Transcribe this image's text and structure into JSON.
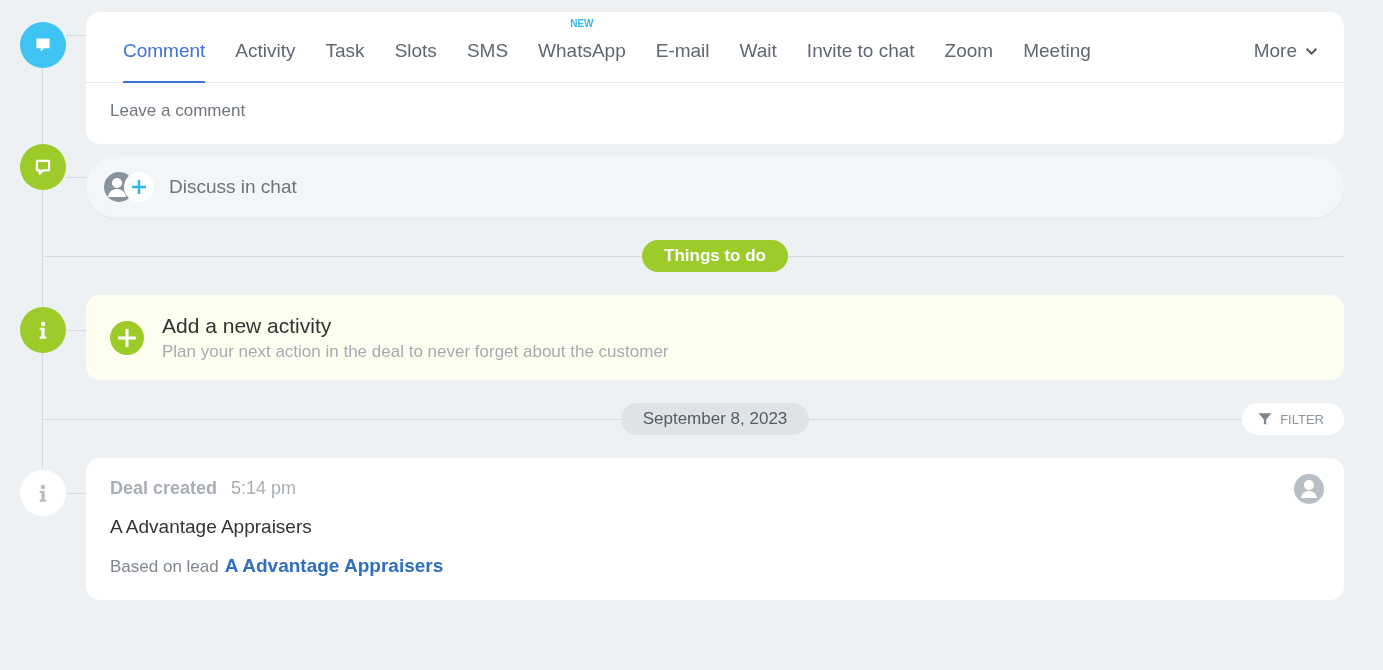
{
  "composer": {
    "tabs": [
      {
        "label": "Comment",
        "selected": true
      },
      {
        "label": "Activity",
        "selected": false
      },
      {
        "label": "Task",
        "selected": false
      },
      {
        "label": "Slots",
        "selected": false
      },
      {
        "label": "SMS",
        "selected": false
      },
      {
        "label": "WhatsApp",
        "selected": false,
        "badge": "NEW"
      },
      {
        "label": "E-mail",
        "selected": false
      },
      {
        "label": "Wait",
        "selected": false
      },
      {
        "label": "Invite to chat",
        "selected": false
      },
      {
        "label": "Zoom",
        "selected": false
      },
      {
        "label": "Meeting",
        "selected": false
      }
    ],
    "more": "More",
    "placeholder": "Leave a comment"
  },
  "chat": {
    "label": "Discuss in chat"
  },
  "things_to_do": {
    "label": "Things to do"
  },
  "new_activity": {
    "title": "Add a new activity",
    "subtitle": "Plan your next action in the deal to never forget about the customer"
  },
  "date_separator": {
    "date": "September 8, 2023",
    "filter": "FILTER"
  },
  "events": [
    {
      "title": "Deal created",
      "time": "5:14 pm",
      "text": "A Advantage Appraisers",
      "source_label": "Based on lead",
      "source_link": "A Advantage Appraisers"
    }
  ]
}
